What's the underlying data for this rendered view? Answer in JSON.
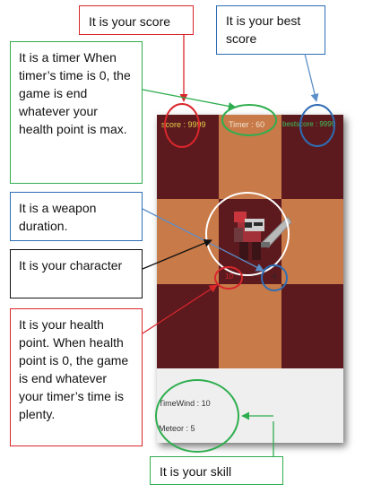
{
  "callouts": {
    "score": "It is your score",
    "best_score": "It is your best score",
    "timer": "It is a timer When timer’s time is 0, the game is end whatever your health point is max.",
    "weapon": "It is a weapon duration.",
    "character": "It is your character",
    "health": "It is your health point. When health point is 0, the game is end whatever your timer’s time is plenty.",
    "skill": "It is your skill"
  },
  "hud": {
    "score": "score : 9999",
    "timer": "Timer : 60",
    "best_score": "bestscore : 9999",
    "health": "10",
    "weapon_duration": "4"
  },
  "skills": {
    "time_wind": "TimeWind : 10",
    "meteor": "Meteor : 5"
  },
  "colors": {
    "dark_tile": "#5c1a1e",
    "light_tile": "#c87a48",
    "score_text": "#e8d04a",
    "best_text": "#3fc05a",
    "red": "#d9262b",
    "blue": "#2f6db5",
    "green": "#2fae4f"
  }
}
